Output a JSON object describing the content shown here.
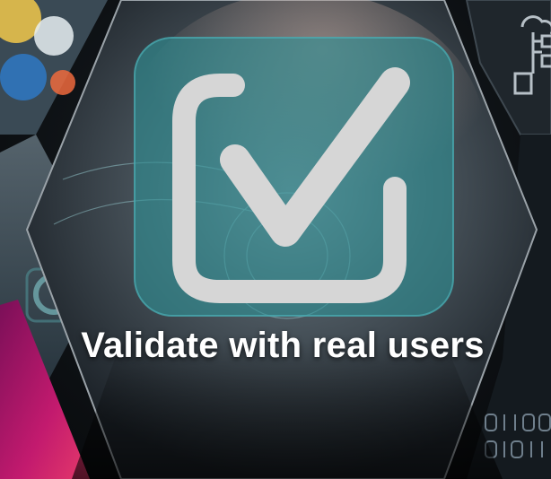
{
  "slide": {
    "title": "Validate with real users"
  },
  "icons": {
    "main": "checkbox-check-icon",
    "top_right": "cloud-network-icon",
    "right_edge": "binary-code-icon"
  },
  "colors": {
    "overlay_teal": "#2f8f95",
    "check_gray": "#d6d6d6",
    "text": "#ffffff",
    "magenta": "#b0166e",
    "binary": "#6f7f8c"
  }
}
